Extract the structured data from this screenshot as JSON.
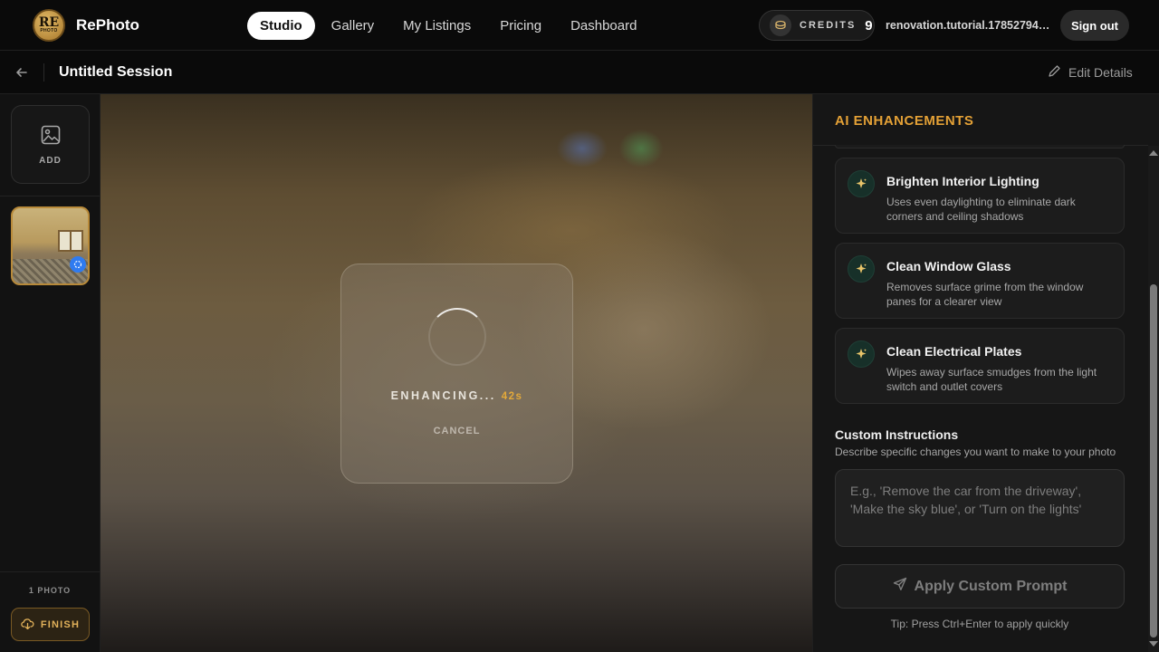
{
  "app": {
    "logo_text": "RE",
    "logo_subtext": "PHOTO",
    "brand": "RePhoto"
  },
  "nav": {
    "items": [
      {
        "label": "Studio",
        "active": true
      },
      {
        "label": "Gallery",
        "active": false
      },
      {
        "label": "My Listings",
        "active": false
      },
      {
        "label": "Pricing",
        "active": false
      },
      {
        "label": "Dashboard",
        "active": false
      }
    ]
  },
  "credits": {
    "label": "CREDITS",
    "count": "9"
  },
  "user": {
    "email": "renovation.tutorial.1785279469..."
  },
  "actions": {
    "sign_out": "Sign out"
  },
  "session": {
    "title": "Untitled Session",
    "edit_label": "Edit Details"
  },
  "sidebar": {
    "add_label": "ADD",
    "photo_count": "1 PHOTO",
    "finish_label": "FINISH"
  },
  "processing": {
    "status": "ENHANCING...",
    "timer": "42s",
    "cancel_label": "CANCEL"
  },
  "enhancements": {
    "title": "AI ENHANCEMENTS",
    "cards": [
      {
        "title": "Brighten Interior Lighting",
        "description": "Uses even daylighting to eliminate dark corners and ceiling shadows"
      },
      {
        "title": "Clean Window Glass",
        "description": "Removes surface grime from the window panes for a clearer view"
      },
      {
        "title": "Clean Electrical Plates",
        "description": "Wipes away surface smudges from the light switch and outlet covers"
      }
    ]
  },
  "custom": {
    "title": "Custom Instructions",
    "subtitle": "Describe specific changes you want to make to your photo",
    "placeholder": "E.g., 'Remove the car from the driveway', 'Make the sky blue', or 'Turn on the lights'",
    "value": "",
    "apply_label": "Apply Custom Prompt",
    "tip": "Tip: Press Ctrl+Enter to apply quickly"
  },
  "colors": {
    "accent": "#e4a136",
    "timer": "#e3a93a",
    "badge": "#2f7bf0"
  }
}
